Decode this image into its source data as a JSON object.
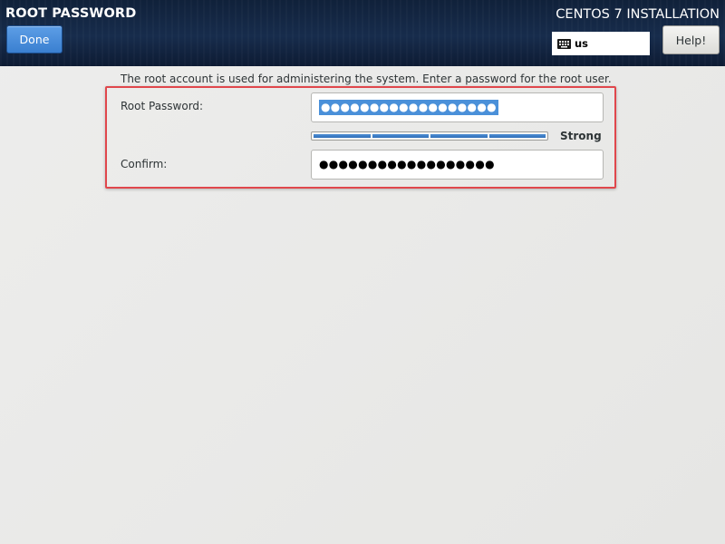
{
  "header": {
    "screen_title": "ROOT PASSWORD",
    "done_label": "Done",
    "product_title": "CENTOS 7 INSTALLATION",
    "keyboard_layout": "us",
    "keyboard_icon": "keyboard-icon",
    "help_label": "Help!"
  },
  "form": {
    "intro": "The root account is used for administering the system.  Enter a password for the root user.",
    "root_password_label": "Root Password:",
    "root_password_value": "●●●●●●●●●●●●●●●●●●",
    "root_password_selected": true,
    "confirm_label": "Confirm:",
    "confirm_value": "●●●●●●●●●●●●●●●●●●",
    "strength": {
      "label": "Strong",
      "level": 4,
      "max": 4
    }
  },
  "colors": {
    "header_bg": "#172c4c",
    "accent_blue": "#3a7fd0",
    "highlight_border": "#e0474c",
    "selection_bg": "#4a90d9"
  }
}
